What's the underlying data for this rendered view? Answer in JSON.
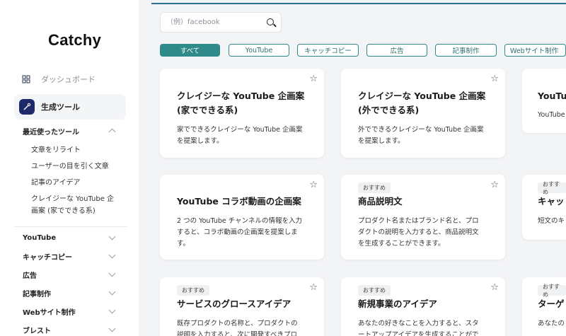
{
  "app": {
    "logo": "Catchy"
  },
  "sidebar": {
    "dashboard": "ダッシュボード",
    "generate_tools": "生成ツール",
    "recent": {
      "label": "最近使ったツール",
      "items": [
        "文章をリライト",
        "ユーザーの目を引く文章",
        "記事のアイデア",
        "クレイジーな YouTube 企",
        "画案 (家でできる系)"
      ]
    },
    "categories": [
      "YouTube",
      "キャッチコピー",
      "広告",
      "記事制作",
      "Webサイト制作",
      "ブレスト"
    ]
  },
  "search": {
    "placeholder": "（例）facebook"
  },
  "filters": [
    "すべて",
    "YouTube",
    "キャッチコピー",
    "広告",
    "記事制作",
    "Webサイト制作"
  ],
  "cards": [
    {
      "title1": "クレイジーな YouTube 企画案",
      "title2": "(家でできる系)",
      "desc1": "家でできるクレイジーな YouTube 企画案",
      "desc2": "を提案します。"
    },
    {
      "title1": "クレイジーな YouTube 企画案",
      "title2": "(外でできる系)",
      "desc1": "外でできるクレイジーな YouTube 企画案",
      "desc2": "を提案します。"
    },
    {
      "title1": "YouTu",
      "desc1": "YouTube"
    },
    {
      "title1": "YouTube コラボ動画の企画案",
      "desc1": "2 つの YouTube チャンネルの情報を入力",
      "desc2": "すると、コラボ動画の企画案を提案しま",
      "desc3": "す。"
    },
    {
      "badge": "おすすめ",
      "title1": "商品説明文",
      "desc1": "プロダクト名またはブランド名と、プロ",
      "desc2": "ダクトの説明を入力すると、商品説明文",
      "desc3": "を生成することができます。"
    },
    {
      "badge": "おすすめ",
      "title1": "キャッ",
      "desc1": "短文のキ"
    },
    {
      "badge": "おすすめ",
      "title1": "サービスのグロースアイデア",
      "desc1": "既存プロダクトの名称と、プロダクトの",
      "desc2": "説明を入力すると、次に開発すべきプロ"
    },
    {
      "badge": "おすすめ",
      "title1": "新規事業のアイデア",
      "desc1": "あなたの好きなことを入力すると、スタ",
      "desc2": "ートアップアイデアを生成することがで"
    },
    {
      "badge": "おすすめ",
      "title1": "ターゲ",
      "desc1": "あなたの"
    }
  ]
}
